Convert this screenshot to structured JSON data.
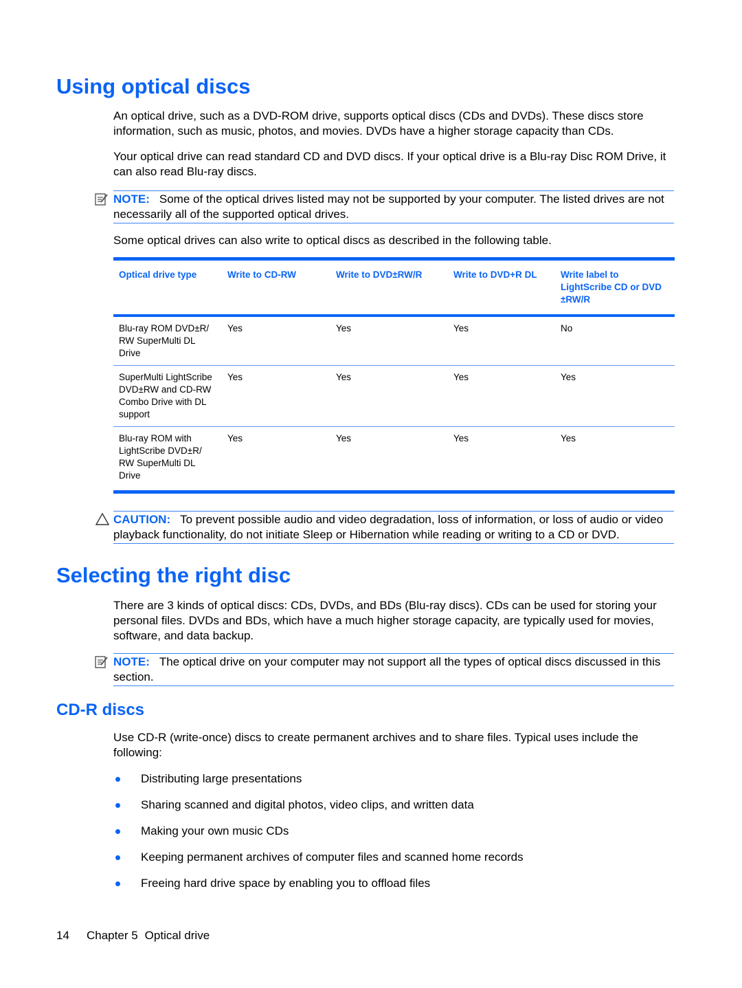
{
  "section1": {
    "title": "Using optical discs",
    "paragraphs": [
      "An optical drive, such as a DVD-ROM drive, supports optical discs (CDs and DVDs). These discs store information, such as music, photos, and movies. DVDs have a higher storage capacity than CDs.",
      "Your optical drive can read standard CD and DVD discs. If your optical drive is a Blu-ray Disc ROM Drive, it can also read Blu-ray discs."
    ],
    "note": {
      "label": "NOTE:",
      "icon": "note-icon",
      "text": "Some of the optical drives listed may not be supported by your computer. The listed drives are not necessarily all of the supported optical drives."
    },
    "table_intro": "Some optical drives can also write to optical discs as described in the following table.",
    "table": {
      "headers": [
        "Optical drive type",
        "Write to CD-RW",
        "Write to DVD±RW/R",
        "Write to DVD+R DL",
        "Write label to LightScribe CD or DVD ±RW/R"
      ],
      "rows": [
        [
          "Blu-ray ROM DVD±R/ RW SuperMulti DL Drive",
          "Yes",
          "Yes",
          "Yes",
          "No"
        ],
        [
          "SuperMulti LightScribe DVD±RW and CD-RW Combo Drive with DL support",
          "Yes",
          "Yes",
          "Yes",
          "Yes"
        ],
        [
          "Blu-ray ROM with LightScribe DVD±R/ RW SuperMulti DL Drive",
          "Yes",
          "Yes",
          "Yes",
          "Yes"
        ]
      ]
    },
    "caution": {
      "label": "CAUTION:",
      "icon": "caution-triangle-icon",
      "text": "To prevent possible audio and video degradation, loss of information, or loss of audio or video playback functionality, do not initiate Sleep or Hibernation while reading or writing to a CD or DVD."
    }
  },
  "section2": {
    "title": "Selecting the right disc",
    "paragraph": "There are 3 kinds of optical discs: CDs, DVDs, and BDs (Blu-ray discs). CDs can be used for storing your personal files. DVDs and BDs, which have a much higher storage capacity, are typically used for movies, software, and data backup.",
    "note": {
      "label": "NOTE:",
      "icon": "note-icon",
      "text": "The optical drive on your computer may not support all the types of optical discs discussed in this section."
    }
  },
  "section3": {
    "title": "CD-R discs",
    "paragraph": "Use CD-R (write-once) discs to create permanent archives and to share files. Typical uses include the following:",
    "bullets": [
      "Distributing large presentations",
      "Sharing scanned and digital photos, video clips, and written data",
      "Making your own music CDs",
      "Keeping permanent archives of computer files and scanned home records",
      "Freeing hard drive space by enabling you to offload files"
    ]
  },
  "footer": {
    "page_number": "14",
    "chapter": "Chapter 5",
    "chapter_title": "Optical drive"
  },
  "colors": {
    "accent": "#0a64f5"
  }
}
